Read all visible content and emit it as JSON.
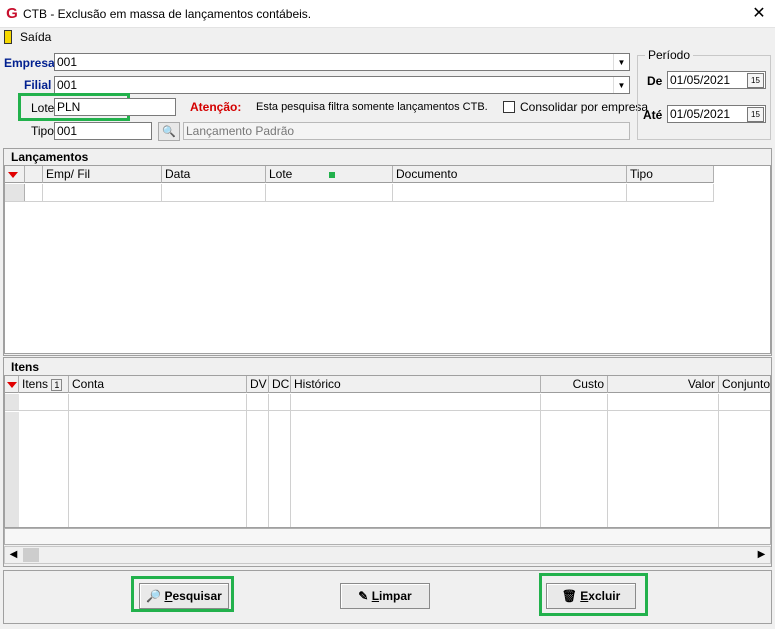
{
  "window": {
    "title": "CTB - Exclusão em massa de lançamentos contábeis.",
    "app_icon": "G",
    "close": "✕"
  },
  "menu": {
    "exit_label": "Saída"
  },
  "form": {
    "empresa_label": "Empresa",
    "empresa_value": "001",
    "filial_label": "Filial",
    "filial_value": "001",
    "lote_label": "Lote",
    "lote_value": "PLN",
    "tipo_label": "Tipo",
    "tipo_value": "001",
    "tipo_desc": "Lançamento Padrão",
    "atencao_label": "Atenção:",
    "atencao_text": "Esta pesquisa filtra somente lançamentos CTB.",
    "consolidar_label": "Consolidar por empresa"
  },
  "periodo": {
    "legend": "Período",
    "de_label": "De",
    "de_value": "01/05/2021",
    "ate_label": "Até",
    "ate_value": "01/05/2021",
    "cal_icon": "15"
  },
  "lancamentos": {
    "title": "Lançamentos",
    "columns": [
      "Emp/ Fil",
      "Data",
      "Lote",
      "Documento",
      "Tipo"
    ]
  },
  "itens": {
    "title": "Itens",
    "columns": [
      "Itens",
      "Conta",
      "DV",
      "DC",
      "Histórico",
      "Custo",
      "Valor",
      "Conjunto"
    ],
    "sort_badge": "1"
  },
  "buttons": {
    "pesquisar_u": "P",
    "pesquisar_rest": "esquisar",
    "limpar_u": "L",
    "limpar_rest": "impar",
    "excluir_u": "E",
    "excluir_rest": "xcluir"
  },
  "colors": {
    "highlight": "#22b14c",
    "atencao": "#d40000",
    "label_blue": "#001f8f"
  }
}
